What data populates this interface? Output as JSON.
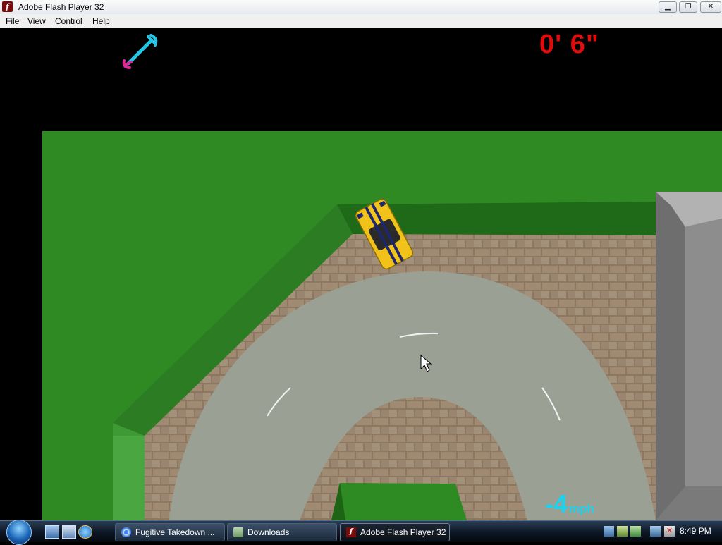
{
  "window": {
    "title": "Adobe Flash Player 32",
    "menu": [
      "File",
      "View",
      "Control",
      "Help"
    ]
  },
  "hud": {
    "timer": "0' 6\"",
    "speed_value": "-4",
    "speed_unit": "mph",
    "colors": {
      "timer": "#e30b0b",
      "speed": "#19d3f0",
      "wrench": "#22c6e8"
    }
  },
  "taskbar": {
    "items": [
      {
        "label": "Fugitive Takedown ...",
        "icon": "chrome-icon",
        "active": false
      },
      {
        "label": "Downloads",
        "icon": "folder-icon",
        "active": false
      },
      {
        "label": "Adobe Flash Player 32",
        "icon": "flash-icon",
        "active": true
      }
    ],
    "clock": "8:49 PM"
  }
}
